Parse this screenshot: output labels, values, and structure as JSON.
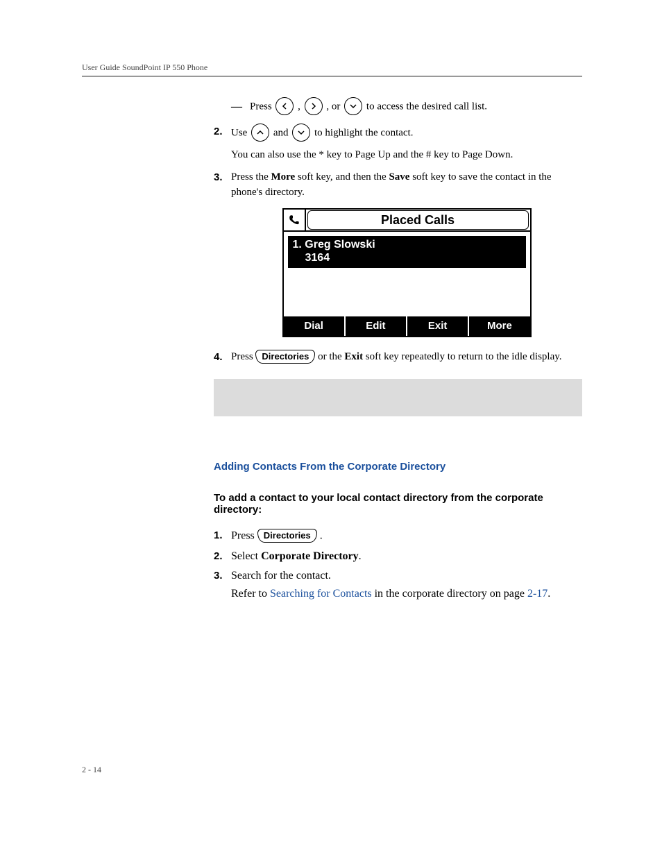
{
  "header": "User Guide SoundPoint IP 550 Phone",
  "page_number": "2 - 14",
  "bullet_dash": {
    "text_before": "Press ",
    "text_mid1": " , ",
    "text_mid2": " , or ",
    "text_after": " to access the desired call list."
  },
  "step2": {
    "num": "2.",
    "before": "Use ",
    "mid": " and ",
    "after": " to highlight the contact.",
    "sub": "You can also use the * key to Page Up and the # key to Page Down."
  },
  "step3": {
    "num": "3.",
    "t1": "Press the ",
    "b1": "More",
    "t2": " soft key, and then the ",
    "b2": "Save",
    "t3": " soft key to save the contact in the phone's directory."
  },
  "phone": {
    "title": "Placed Calls",
    "row_name": "1. Greg Slowski",
    "row_num": "3164",
    "softkeys": [
      "Dial",
      "Edit",
      "Exit",
      "More"
    ]
  },
  "step4": {
    "num": "4.",
    "t1": "Press ",
    "key": "Directories",
    "t2": " or the ",
    "b1": "Exit",
    "t3": " soft key repeatedly to return to the idle display."
  },
  "heading_blue": "Adding Contacts From the Corporate Directory",
  "heading_black": "To add a contact to your local contact directory from the corporate directory:",
  "b_step1": {
    "num": "1.",
    "t1": "Press ",
    "key": "Directories",
    "t2": " ."
  },
  "b_step2": {
    "num": "2.",
    "t1": "Select ",
    "b1": "Corporate Directory",
    "t2": "."
  },
  "b_step3": {
    "num": "3.",
    "t1": "Search for the contact.",
    "sub_t1": "Refer to ",
    "sub_link": "Searching for Contacts",
    "sub_t2": " in the corporate directory on page ",
    "sub_link2": "2-17",
    "sub_t3": "."
  }
}
